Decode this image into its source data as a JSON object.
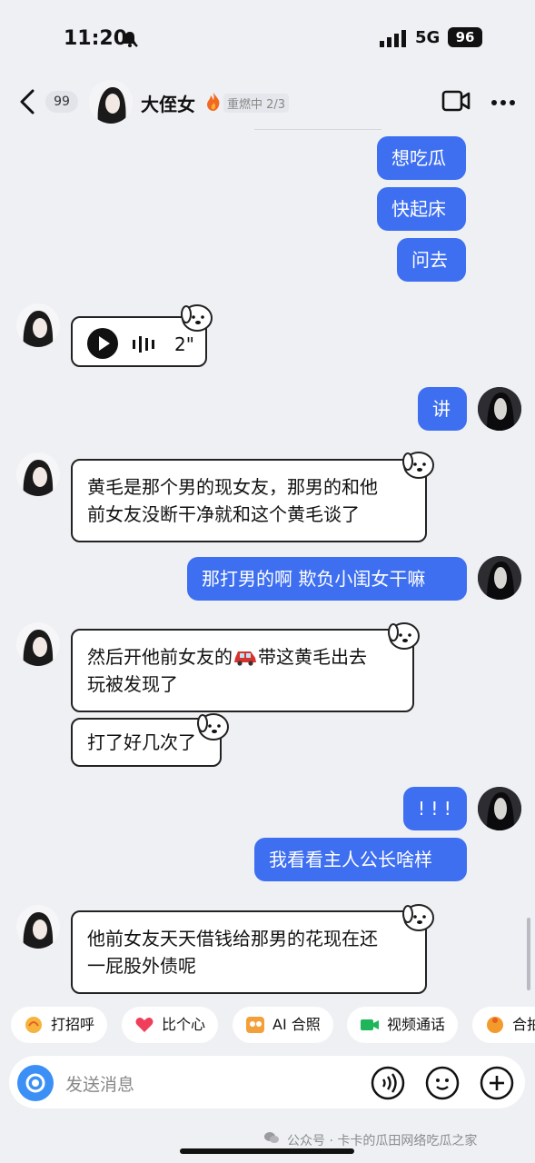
{
  "status_bar": {
    "time": "11:20",
    "network": "5G",
    "battery": "96"
  },
  "header": {
    "unread_count": "99",
    "contact_name": "大侄女",
    "streak": "重燃中 2/3"
  },
  "messages": {
    "m1": "想吃瓜",
    "m2": "快起床",
    "m3": "问去",
    "voice_duration": "2\"",
    "m5": "讲",
    "m6_line1": "黄毛是那个男的现女友，那男的和他",
    "m6_line2": "前女友没断干净就和这个黄毛谈了",
    "m7": "那打男的啊 欺负小闺女干嘛",
    "m8_line1a": "然后开他前女友的",
    "m8_line1b": "带这黄毛出去",
    "m8_line2": "玩被发现了",
    "m9": "打了好几次了",
    "m10": "! ! !",
    "m11": "我看看主人公长啥样",
    "m12_line1": "他前女友天天借钱给那男的花现在还",
    "m12_line2": "一屁股外债呢"
  },
  "quick_actions": [
    "打招呼",
    "比个心",
    "AI 合照",
    "视频通话",
    "合拍"
  ],
  "input": {
    "placeholder": "发送消息"
  },
  "watermark": "公众号 · 卡卡的瓜田网络吃瓜之家",
  "colors": {
    "outgoing_bubble": "#3e6ff1",
    "background": "#eef0f4"
  },
  "icons": [
    "back-icon",
    "fire-icon",
    "video-call-icon",
    "more-icon",
    "play-icon",
    "camera-icon",
    "voice-icon",
    "emoji-icon",
    "plus-icon",
    "car-icon",
    "dog-sticker-icon"
  ]
}
